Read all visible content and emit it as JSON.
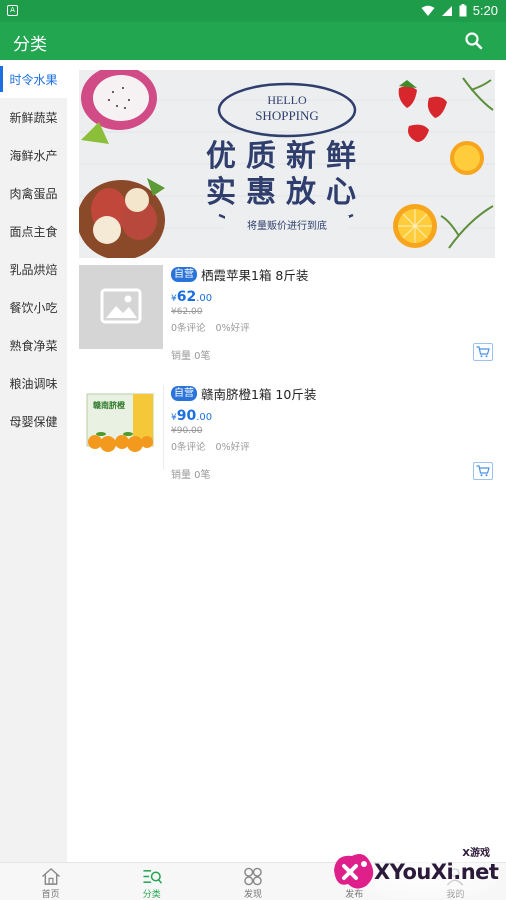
{
  "status_bar": {
    "time": "5:20"
  },
  "app_bar": {
    "title": "分类"
  },
  "categories": [
    {
      "label": "时令水果",
      "active": true
    },
    {
      "label": "新鲜蔬菜"
    },
    {
      "label": "海鲜水产"
    },
    {
      "label": "肉禽蛋品"
    },
    {
      "label": "面点主食"
    },
    {
      "label": "乳品烘焙"
    },
    {
      "label": "餐饮小吃"
    },
    {
      "label": "熟食净菜"
    },
    {
      "label": "粮油调味"
    },
    {
      "label": "母婴保健"
    }
  ],
  "banner": {
    "hello": "HELLO",
    "shopping": "SHOPPING",
    "line1": "优质新鲜",
    "line2": "实惠放心",
    "tagline": "将量贩价进行到底"
  },
  "products": [
    {
      "badge": "自营",
      "name": "栖霞苹果1箱 8斤装",
      "price_symbol": "¥",
      "price_int": "62",
      "price_dec": ".00",
      "original_price": "¥62.00",
      "reviews": "0条评论",
      "good_rate": "0%好评",
      "sales": "销量 0笔"
    },
    {
      "badge": "自营",
      "name": "赣南脐橙1箱 10斤装",
      "price_symbol": "¥",
      "price_int": "90",
      "price_dec": ".00",
      "original_price": "¥90.00",
      "reviews": "0条评论",
      "good_rate": "0%好评",
      "sales": "销量 0笔",
      "box_label": "赣南脐橙"
    }
  ],
  "bottom_nav": [
    {
      "label": "首页",
      "icon": "home-icon"
    },
    {
      "label": "分类",
      "icon": "category-icon",
      "active": true
    },
    {
      "label": "发现",
      "icon": "discover-icon"
    },
    {
      "label": "发布",
      "icon": "publish-icon"
    },
    {
      "label": "我的",
      "icon": "profile-icon"
    }
  ],
  "watermark": {
    "small": "X游戏",
    "text": "XYouXi.net"
  },
  "colors": {
    "primary_green": "#22a650",
    "accent_blue": "#1c6fe0",
    "sidebar_bg": "#f2f2f2"
  }
}
